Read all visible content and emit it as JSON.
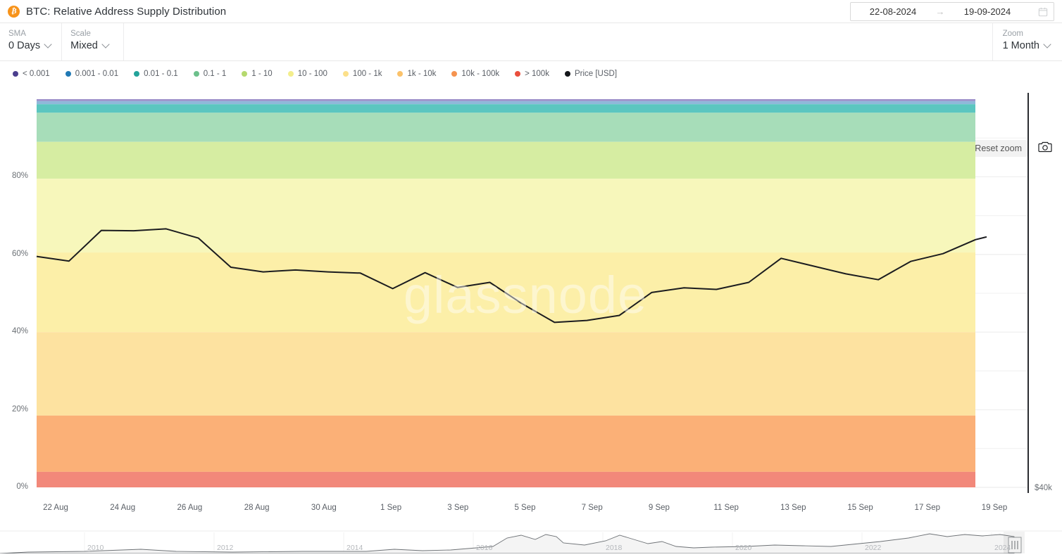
{
  "header": {
    "coin_symbol": "₿",
    "title": "BTC: Relative Address Supply Distribution",
    "date_from": "22-08-2024",
    "date_sep": "→",
    "date_to": "19-09-2024",
    "calendar_icon": "calendar-icon"
  },
  "controls": {
    "sma": {
      "label": "SMA",
      "value": "0 Days"
    },
    "scale": {
      "label": "Scale",
      "value": "Mixed"
    },
    "zoom": {
      "label": "Zoom",
      "value": "1 Month"
    }
  },
  "toolbar": {
    "reset_zoom": "Reset zoom",
    "camera_icon": "camera-icon"
  },
  "watermark": "glassnode",
  "chart_data": {
    "type": "area",
    "title": "BTC: Relative Address Supply Distribution",
    "xlabel": "",
    "ylabel": "",
    "ylim": [
      0,
      100
    ],
    "y_right_label": "$40k",
    "grid": true,
    "legend_position": "top-left",
    "yticks": [
      "0%",
      "20%",
      "40%",
      "60%",
      "80%"
    ],
    "ytick_values": [
      0,
      20,
      40,
      60,
      80
    ],
    "xticks": [
      "22 Aug",
      "24 Aug",
      "26 Aug",
      "28 Aug",
      "30 Aug",
      "1 Sep",
      "3 Sep",
      "5 Sep",
      "7 Sep",
      "9 Sep",
      "11 Sep",
      "13 Sep",
      "15 Sep",
      "17 Sep",
      "19 Sep"
    ],
    "legend": [
      {
        "label": "< 0.001",
        "color": "#4b3f8e"
      },
      {
        "label": "0.001 - 0.01",
        "color": "#2079b4"
      },
      {
        "label": "0.01 - 0.1",
        "color": "#23a39a"
      },
      {
        "label": "0.1 - 1",
        "color": "#6cc08b"
      },
      {
        "label": "1 - 10",
        "color": "#b5d96e"
      },
      {
        "label": "10 - 100",
        "color": "#f3ee8c"
      },
      {
        "label": "100 - 1k",
        "color": "#fce08a"
      },
      {
        "label": "1k - 10k",
        "color": "#fbc26a"
      },
      {
        "label": "10k - 100k",
        "color": "#f5934f"
      },
      {
        "label": "> 100k",
        "color": "#ea4f3d"
      },
      {
        "label": "Price [USD]",
        "color": "#14161a"
      }
    ],
    "bands": [
      {
        "name": "< 0.001",
        "fill": "#9b8ec9",
        "share_pct": 0.5,
        "top_pct": 100.0
      },
      {
        "name": "0.001 - 0.01",
        "fill": "#8fb8da",
        "share_pct": 0.8,
        "top_pct": 99.5
      },
      {
        "name": "0.01 - 0.1",
        "fill": "#5bc6c0",
        "share_pct": 2.2,
        "top_pct": 98.7
      },
      {
        "name": "0.1 - 1",
        "fill": "#a7ddb9",
        "share_pct": 7.5,
        "top_pct": 96.5
      },
      {
        "name": "1 - 10",
        "fill": "#d6eda2",
        "share_pct": 9.5,
        "top_pct": 89.0
      },
      {
        "name": "10 - 100",
        "fill": "#f7f7bb",
        "share_pct": 19.0,
        "top_pct": 79.5
      },
      {
        "name": "100 - 1k",
        "fill": "#fcefa8",
        "share_pct": 20.5,
        "top_pct": 60.5
      },
      {
        "name": "1k - 10k",
        "fill": "#fde2a0",
        "share_pct": 21.5,
        "top_pct": 40.0
      },
      {
        "name": "10k - 100k",
        "fill": "#fbb077",
        "share_pct": 14.5,
        "top_pct": 18.5
      },
      {
        "name": "> 100k",
        "fill": "#f2887a",
        "share_pct": 4.0,
        "top_pct": 4.0
      }
    ],
    "price_series": {
      "name": "Price [USD]",
      "color": "#1b1c1f",
      "x": [
        "22 Aug",
        "22 Aug",
        "23 Aug",
        "24 Aug",
        "25 Aug",
        "26 Aug",
        "27 Aug",
        "28 Aug",
        "29 Aug",
        "30 Aug",
        "31 Aug",
        "1 Sep",
        "2 Sep",
        "3 Sep",
        "4 Sep",
        "5 Sep",
        "6 Sep",
        "7 Sep",
        "8 Sep",
        "9 Sep",
        "10 Sep",
        "11 Sep",
        "12 Sep",
        "13 Sep",
        "14 Sep",
        "15 Sep",
        "16 Sep",
        "17 Sep",
        "18 Sep",
        "19 Sep"
      ],
      "y_pct": [
        59.5,
        58.3,
        66.2,
        66.1,
        66.6,
        64.2,
        56.7,
        55.5,
        56.0,
        55.5,
        55.2,
        51.2,
        55.3,
        51.5,
        52.8,
        47.3,
        42.5,
        43.0,
        44.3,
        50.2,
        51.4,
        51.0,
        52.8,
        59.0,
        57.0,
        55.0,
        53.5,
        58.2,
        60.2,
        63.8
      ]
    }
  },
  "navigator": {
    "years": [
      "2010",
      "2012",
      "2014",
      "2016",
      "2018",
      "2020",
      "2022",
      "2024"
    ],
    "handle": "navigator-handle-right"
  }
}
